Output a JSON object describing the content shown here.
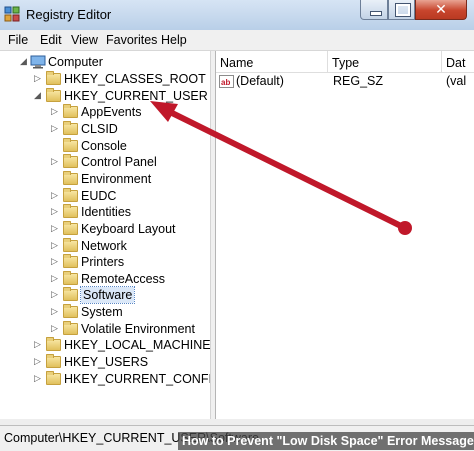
{
  "window": {
    "title": "Registry Editor",
    "close_glyph": "✕"
  },
  "menu": [
    "File",
    "Edit",
    "View",
    "Favorites",
    "Help"
  ],
  "tree": {
    "root": "Computer",
    "items": [
      {
        "label": "HKEY_CLASSES_ROOT",
        "expander": "▷"
      },
      {
        "label": "HKEY_CURRENT_USER",
        "expander": "◢"
      },
      {
        "label": "AppEvents",
        "expander": "▷"
      },
      {
        "label": "CLSID",
        "expander": "▷"
      },
      {
        "label": "Console",
        "expander": ""
      },
      {
        "label": "Control Panel",
        "expander": "▷"
      },
      {
        "label": "Environment",
        "expander": ""
      },
      {
        "label": "EUDC",
        "expander": "▷"
      },
      {
        "label": "Identities",
        "expander": "▷"
      },
      {
        "label": "Keyboard Layout",
        "expander": "▷"
      },
      {
        "label": "Network",
        "expander": "▷"
      },
      {
        "label": "Printers",
        "expander": "▷"
      },
      {
        "label": "RemoteAccess",
        "expander": "▷"
      },
      {
        "label": "Software",
        "expander": "▷"
      },
      {
        "label": "System",
        "expander": "▷"
      },
      {
        "label": "Volatile Environment",
        "expander": "▷"
      },
      {
        "label": "HKEY_LOCAL_MACHINE",
        "expander": "▷"
      },
      {
        "label": "HKEY_USERS",
        "expander": "▷"
      },
      {
        "label": "HKEY_CURRENT_CONFIG",
        "expander": "▷"
      }
    ]
  },
  "list": {
    "columns": [
      "Name",
      "Type",
      "Dat"
    ],
    "rows": [
      {
        "name": "(Default)",
        "type": "REG_SZ",
        "data": "(val"
      }
    ]
  },
  "status": {
    "path": "Computer\\HKEY_CURRENT_USER\\Software"
  },
  "watermark": {
    "text": "How to Prevent \"Low Disk Space\" Error Messages"
  },
  "colors": {
    "annotation_arrow": "#c0182a"
  }
}
